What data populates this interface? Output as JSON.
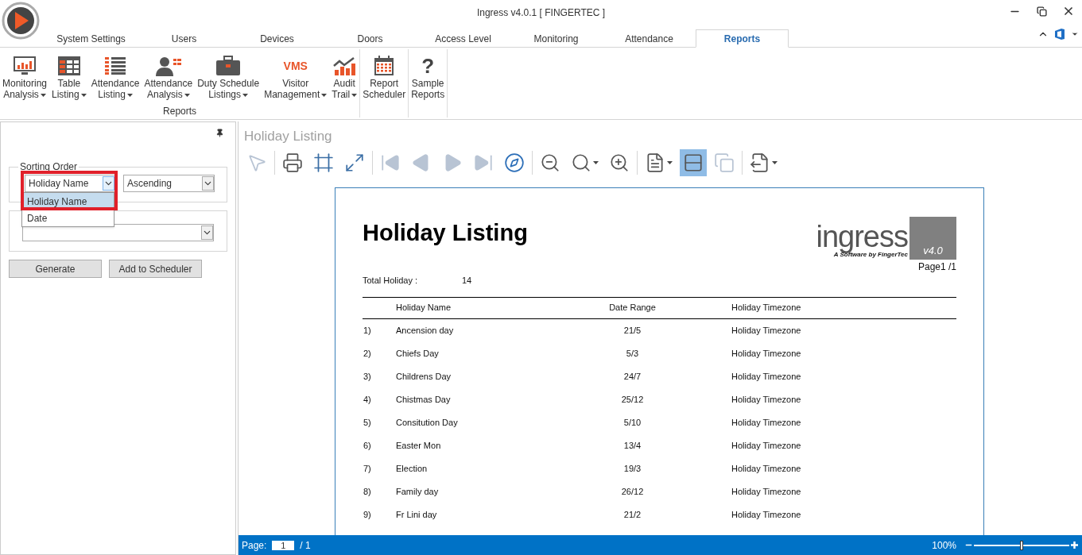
{
  "window": {
    "title": "Ingress v4.0.1 [ FINGERTEC ]"
  },
  "tabs": [
    {
      "label": "System Settings",
      "selected": false
    },
    {
      "label": "Users",
      "selected": false
    },
    {
      "label": "Devices",
      "selected": false
    },
    {
      "label": "Doors",
      "selected": false
    },
    {
      "label": "Access Level",
      "selected": false
    },
    {
      "label": "Monitoring",
      "selected": false
    },
    {
      "label": "Attendance",
      "selected": false
    },
    {
      "label": "Reports",
      "selected": true
    }
  ],
  "ribbon": {
    "groups": [
      {
        "label": "Reports",
        "items": [
          {
            "kind": "monitor",
            "lines": [
              "Monitoring",
              "Analysis"
            ],
            "dropdown": true
          },
          {
            "kind": "table",
            "lines": [
              "Table",
              "Listing"
            ],
            "dropdown": true
          },
          {
            "kind": "list",
            "lines": [
              "Attendance",
              "Listing"
            ],
            "dropdown": true
          },
          {
            "kind": "person",
            "lines": [
              "Attendance",
              "Analysis"
            ],
            "dropdown": true
          },
          {
            "kind": "briefcase",
            "lines": [
              "Duty Schedule",
              "Listings"
            ],
            "dropdown": true
          },
          {
            "kind": "vms",
            "icon_text": "VMS",
            "lines": [
              "Visitor",
              "Management"
            ],
            "dropdown": true
          },
          {
            "kind": "chart",
            "lines": [
              "Audit",
              "Trail"
            ],
            "dropdown": true
          }
        ]
      },
      {
        "items": [
          {
            "kind": "calendar",
            "lines": [
              "Report",
              "Scheduler"
            ],
            "dropdown": false
          }
        ]
      },
      {
        "items": [
          {
            "kind": "question",
            "icon_text": "?",
            "lines": [
              "Sample",
              "Reports"
            ],
            "dropdown": false
          }
        ]
      }
    ]
  },
  "left_panel": {
    "sorting_order": {
      "label": "Sorting Order",
      "field": {
        "value": "Holiday Name"
      },
      "direction": {
        "value": "Ascending"
      },
      "dropdown_options": [
        {
          "label": "Holiday Name",
          "selected": true
        },
        {
          "label": "Date",
          "selected": false
        }
      ]
    },
    "buttons": [
      "Generate",
      "Add to Scheduler"
    ]
  },
  "preview": {
    "title": "Holiday Listing",
    "toolbar": [
      {
        "kind": "select",
        "disabled": true,
        "selected": false
      },
      {
        "kind": "sep"
      },
      {
        "kind": "print",
        "disabled": false,
        "selected": false
      },
      {
        "kind": "margins",
        "disabled": false,
        "selected": false
      },
      {
        "kind": "fit",
        "disabled": false,
        "selected": false
      },
      {
        "kind": "sep"
      },
      {
        "kind": "first",
        "disabled": true,
        "selected": false
      },
      {
        "kind": "prev",
        "disabled": true,
        "selected": false
      },
      {
        "kind": "next",
        "disabled": true,
        "selected": false
      },
      {
        "kind": "last",
        "disabled": true,
        "selected": false
      },
      {
        "kind": "compass",
        "disabled": false,
        "selected": false
      },
      {
        "kind": "sep"
      },
      {
        "kind": "zoom-out",
        "disabled": false,
        "selected": false
      },
      {
        "kind": "zoom",
        "disabled": false,
        "selected": false
      },
      {
        "kind": "zoom-in",
        "disabled": false,
        "selected": false
      },
      {
        "kind": "sep"
      },
      {
        "kind": "page",
        "disabled": false,
        "selected": false
      },
      {
        "kind": "one-page",
        "disabled": false,
        "selected": true
      },
      {
        "kind": "multi-page",
        "disabled": true,
        "selected": false
      },
      {
        "kind": "sep"
      },
      {
        "kind": "export",
        "disabled": false,
        "selected": false
      }
    ],
    "report": {
      "title": "Holiday Listing",
      "logo_text": "ingress",
      "logo_sub": "A Software by FingerTec",
      "logo_version": "v4.0",
      "page": "Page1 /1",
      "total_label": "Total Holiday :",
      "total_value": "14",
      "columns": [
        "Holiday Name",
        "Date Range",
        "Holiday Timezone"
      ],
      "rows": [
        {
          "no": "1)",
          "name": "Ancension day",
          "date": "21/5",
          "timezone": "Holiday Timezone"
        },
        {
          "no": "2)",
          "name": "Chiefs Day",
          "date": "5/3",
          "timezone": "Holiday Timezone"
        },
        {
          "no": "3)",
          "name": "Childrens Day",
          "date": "24/7",
          "timezone": "Holiday Timezone"
        },
        {
          "no": "4)",
          "name": "Chistmas Day",
          "date": "25/12",
          "timezone": "Holiday Timezone"
        },
        {
          "no": "5)",
          "name": "Consitution Day",
          "date": "5/10",
          "timezone": "Holiday Timezone"
        },
        {
          "no": "6)",
          "name": "Easter Mon",
          "date": "13/4",
          "timezone": "Holiday Timezone"
        },
        {
          "no": "7)",
          "name": "Election",
          "date": "19/3",
          "timezone": "Holiday Timezone"
        },
        {
          "no": "8)",
          "name": "Family day",
          "date": "26/12",
          "timezone": "Holiday Timezone"
        },
        {
          "no": "9)",
          "name": "Fr Lini day",
          "date": "21/2",
          "timezone": "Holiday Timezone"
        }
      ]
    }
  },
  "status_bar": {
    "page_label": "Page:",
    "page_value": "1",
    "page_total": "/ 1",
    "zoom": "100%",
    "zoom_slider": {
      "level": 0.5
    }
  }
}
